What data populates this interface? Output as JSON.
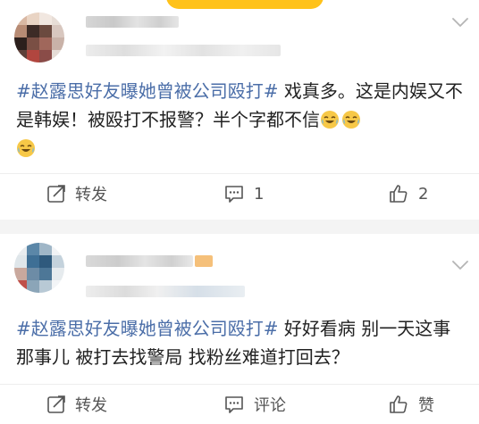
{
  "posts": [
    {
      "content_topic": "#赵露思好友曝她曾被公司殴打#",
      "content_text": " 戏真多。这是内娱又不是韩娱！被殴打不报警？半个字都不信",
      "emoji": "laughing-tears-emoji",
      "actions": {
        "repost_label": "转发",
        "comment_count": "1",
        "like_count": "2"
      }
    },
    {
      "content_topic": "#赵露思好友曝她曾被公司殴打#",
      "content_text": " 好好看病 别一天这事那事儿 被打去找警局 找粉丝难道打回去？",
      "actions": {
        "repost_label": "转发",
        "comment_label": "评论",
        "like_label": "赞"
      }
    }
  ],
  "colors": {
    "topic_link": "#4b6ea8",
    "text": "#222222",
    "action_text": "#555555",
    "divider_gap": "#f4f4f4",
    "accent_pill": "#ffc21a"
  },
  "icons": [
    "chevron-down-icon",
    "repost-icon",
    "comment-icon",
    "like-icon"
  ]
}
